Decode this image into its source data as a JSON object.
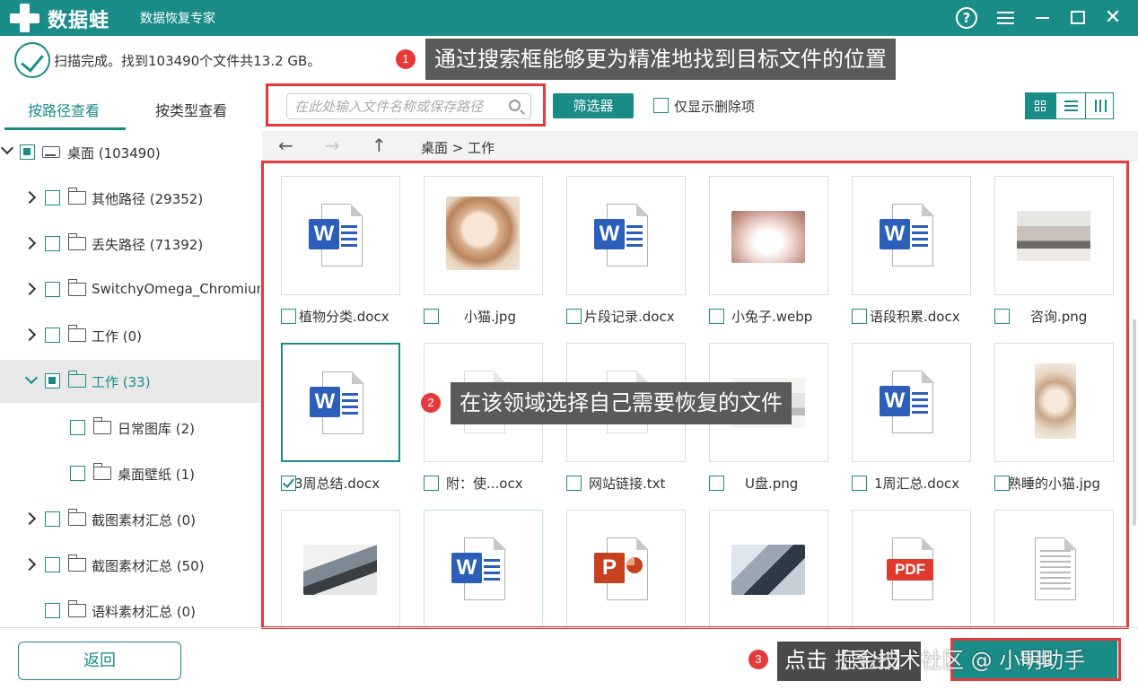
{
  "app": {
    "name": "数据蛙",
    "subtitle": "数据恢复专家"
  },
  "status": {
    "text": "扫描完成。找到103490个文件共13.2 GB。"
  },
  "annotations": {
    "step1": {
      "num": "1",
      "text": "通过搜索框能够更为精准地找到目标文件的位置"
    },
    "step2": {
      "num": "2",
      "text": "在该领域选择自己需要恢复的文件"
    },
    "step3": {
      "num": "3",
      "text": "点击【导出】"
    }
  },
  "tabs": [
    {
      "label": "按路径查看"
    },
    {
      "label": "按类型查看"
    }
  ],
  "tree": [
    {
      "label": "桌面 (103490)"
    },
    {
      "label": "其他路径 (29352)"
    },
    {
      "label": "丢失路径 (71392)"
    },
    {
      "label": "SwitchyOmega_Chromium"
    },
    {
      "label": "工作 (0)"
    },
    {
      "label": "工作 (33)"
    },
    {
      "label": "日常图库 (2)"
    },
    {
      "label": "桌面壁纸 (1)"
    },
    {
      "label": "截图素材汇总 (0)"
    },
    {
      "label": "截图素材汇总 (50)"
    },
    {
      "label": "语料素材汇总 (0)"
    }
  ],
  "toolbar": {
    "search_placeholder": "在此处输入文件名称或保存路径",
    "filter_label": "筛选器",
    "only_deleted_label": "仅显示删除项"
  },
  "nav": {
    "back": "←",
    "forward": "→",
    "up": "↑",
    "breadcrumb": "桌面 > 工作"
  },
  "files": [
    {
      "name": "植物分类.docx",
      "type": "word",
      "checked": false
    },
    {
      "name": "小猫.jpg",
      "type": "photo-cat",
      "checked": false
    },
    {
      "name": "片段记录.docx",
      "type": "word",
      "checked": false
    },
    {
      "name": "小兔子.webp",
      "type": "photo-bunny",
      "checked": false
    },
    {
      "name": "语段积累.docx",
      "type": "word",
      "checked": false
    },
    {
      "name": "咨询.png",
      "type": "photo-office",
      "checked": false
    },
    {
      "name": "3周总结.docx",
      "type": "word",
      "checked": true
    },
    {
      "name": "附：使...ocx",
      "type": "word-faded",
      "checked": false
    },
    {
      "name": "网站链接.txt",
      "type": "txt",
      "checked": false
    },
    {
      "name": "U盘.png",
      "type": "photo-faded",
      "checked": false
    },
    {
      "name": "1周汇总.docx",
      "type": "word",
      "checked": false
    },
    {
      "name": "熟睡的小猫.jpg",
      "type": "photo-cats",
      "checked": false
    },
    {
      "name": "",
      "type": "photo-laptop",
      "checked": false
    },
    {
      "name": "",
      "type": "word",
      "checked": false
    },
    {
      "name": "",
      "type": "ppt",
      "checked": false
    },
    {
      "name": "",
      "type": "photo-work",
      "checked": false
    },
    {
      "name": "",
      "type": "pdf",
      "checked": false
    },
    {
      "name": "",
      "type": "txt",
      "checked": false
    }
  ],
  "footer": {
    "back_label": "返回",
    "export_label": "导出"
  },
  "watermark": "掘金技术社区 @ 小明助手",
  "colors": {
    "accent": "#1a8c87",
    "annotation_red": "#e63a3a"
  }
}
